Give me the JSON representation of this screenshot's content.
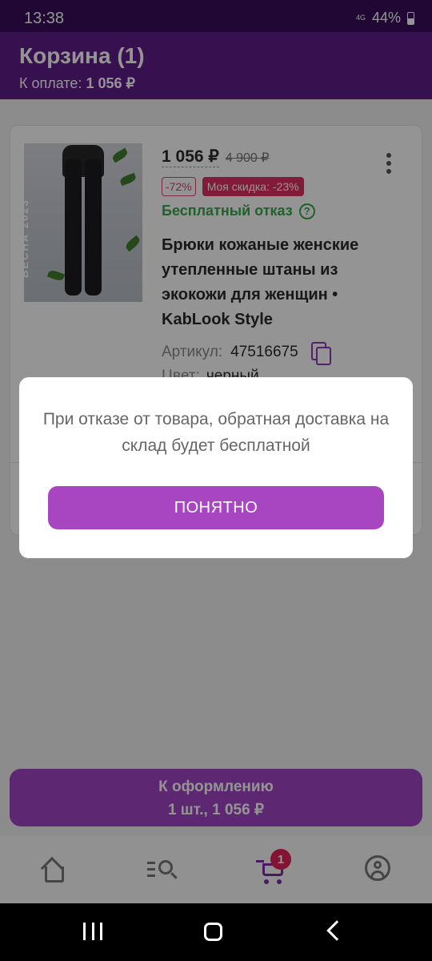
{
  "status_bar": {
    "time": "13:38",
    "network": "4G",
    "battery": "44%"
  },
  "header": {
    "title": "Корзина (1)",
    "pay_label": "К оплате:",
    "pay_amount": "1 056 ₽"
  },
  "product": {
    "image_text": "ВЕСНА 2023",
    "price": "1 056 ₽",
    "old_price": "4 900 ₽",
    "discount_badge": "-72%",
    "my_discount_badge": "Моя скидка: -23%",
    "free_refusal": "Бесплатный отказ",
    "free_refusal_icon": "?",
    "title": "Брюки кожаные женские утепленные штаны из экокожи для женщин • KabLook Style",
    "article_label": "Артикул:",
    "article_value": "47516675",
    "color_label": "Цвет:",
    "color_value": "черный"
  },
  "checkout": {
    "title": "К оформлению",
    "summary": "1 шт., 1 056 ₽"
  },
  "bottom_nav": {
    "cart_badge": "1"
  },
  "dialog": {
    "message": "При отказе от товара, обратная доставка на склад будет бесплатной",
    "button": "ПОНЯТНО"
  },
  "colors": {
    "header": "#5f1d8a",
    "accent": "#a846c2",
    "free_green": "#3aa84a",
    "badge_red": "#e02f63"
  }
}
